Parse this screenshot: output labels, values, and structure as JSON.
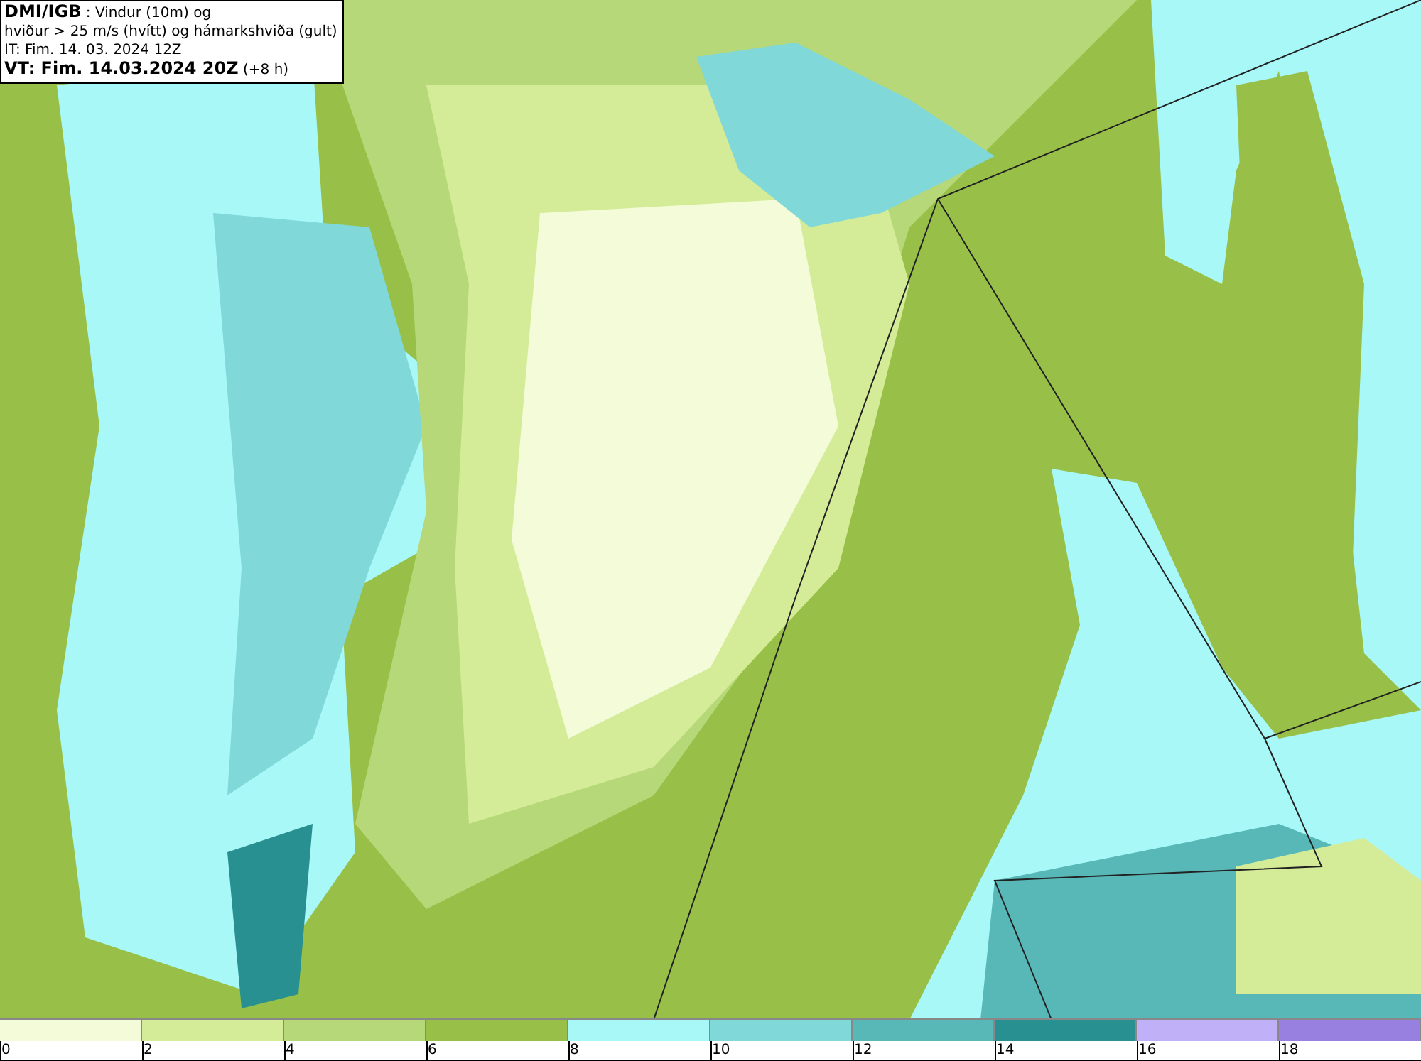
{
  "info_box": {
    "lines": [
      "**DMI/IGB** : Vindur (10m) og",
      "hviður > 25 m/s (hvítt) og hámarkshviða (gult)",
      "IT: Fim. 14. 03. 2024 12Z",
      "**VT: Fim. 14.03.2024 20Z** (+8 h)"
    ]
  },
  "legend": {
    "segments": [
      {
        "color": "#f4fbd8"
      },
      {
        "color": "#d4ec98"
      },
      {
        "color": "#b6d878"
      },
      {
        "color": "#98c048"
      },
      {
        "color": "#a8f8f8"
      },
      {
        "color": "#80d8d8"
      },
      {
        "color": "#58b8b8"
      },
      {
        "color": "#289090"
      },
      {
        "color": "#c0b0f8"
      },
      {
        "color": "#9880e0"
      }
    ],
    "ticks": [
      "0",
      "2",
      "4",
      "6",
      "8",
      "10",
      "12",
      "14",
      "16",
      "18"
    ]
  }
}
